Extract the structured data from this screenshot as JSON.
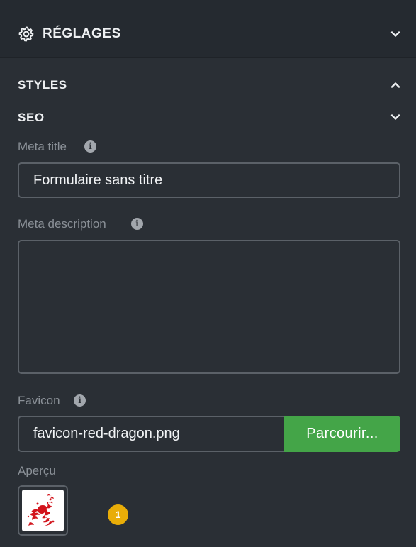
{
  "header": {
    "title": "RÉGLAGES",
    "icon": "gear-icon",
    "toggle_icon": "chevron-down-icon"
  },
  "sections": {
    "styles": {
      "label": "STYLES",
      "toggle_icon": "chevron-up-icon"
    },
    "seo": {
      "label": "SEO",
      "toggle_icon": "chevron-down-icon"
    }
  },
  "seo": {
    "meta_title_label": "Meta title",
    "meta_title_value": "Formulaire sans titre",
    "meta_description_label": "Meta description",
    "meta_description_value": "",
    "favicon_label": "Favicon",
    "favicon_value": "favicon-red-dragon.png",
    "browse_label": "Parcourir...",
    "preview_label": "Aperçu",
    "info_glyph": "i"
  },
  "badge": {
    "count": "1"
  },
  "colors": {
    "background": "#2a2f35",
    "header_background": "#252a30",
    "browse_button": "#44a548",
    "badge": "#e9ad08",
    "dragon": "#d2141c"
  }
}
